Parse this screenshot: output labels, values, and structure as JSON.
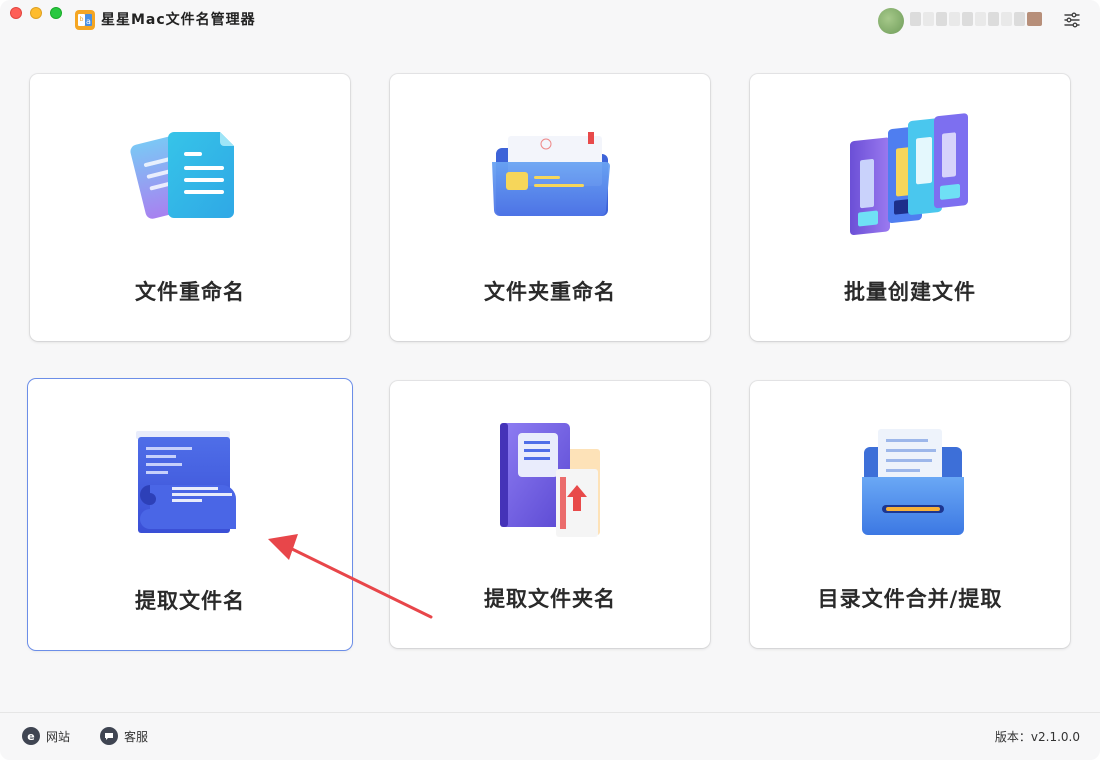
{
  "app": {
    "title": "星星Mac文件名管理器"
  },
  "cards": [
    {
      "label": "文件重命名",
      "icon": "documents-icon"
    },
    {
      "label": "文件夹重命名",
      "icon": "folder-icon"
    },
    {
      "label": "批量创建文件",
      "icon": "binders-icon"
    },
    {
      "label": "提取文件名",
      "icon": "scroll-document-icon",
      "selected": true
    },
    {
      "label": "提取文件夹名",
      "icon": "book-folder-icon"
    },
    {
      "label": "目录文件合并/提取",
      "icon": "file-drawer-icon"
    }
  ],
  "footer": {
    "website_label": "网站",
    "service_label": "客服",
    "version": "版本：v2.1.0.0"
  },
  "colors": {
    "selected_border": "#6c8ee8",
    "arrow": "#e8464a",
    "accent_blue": "#4e6fe6"
  }
}
